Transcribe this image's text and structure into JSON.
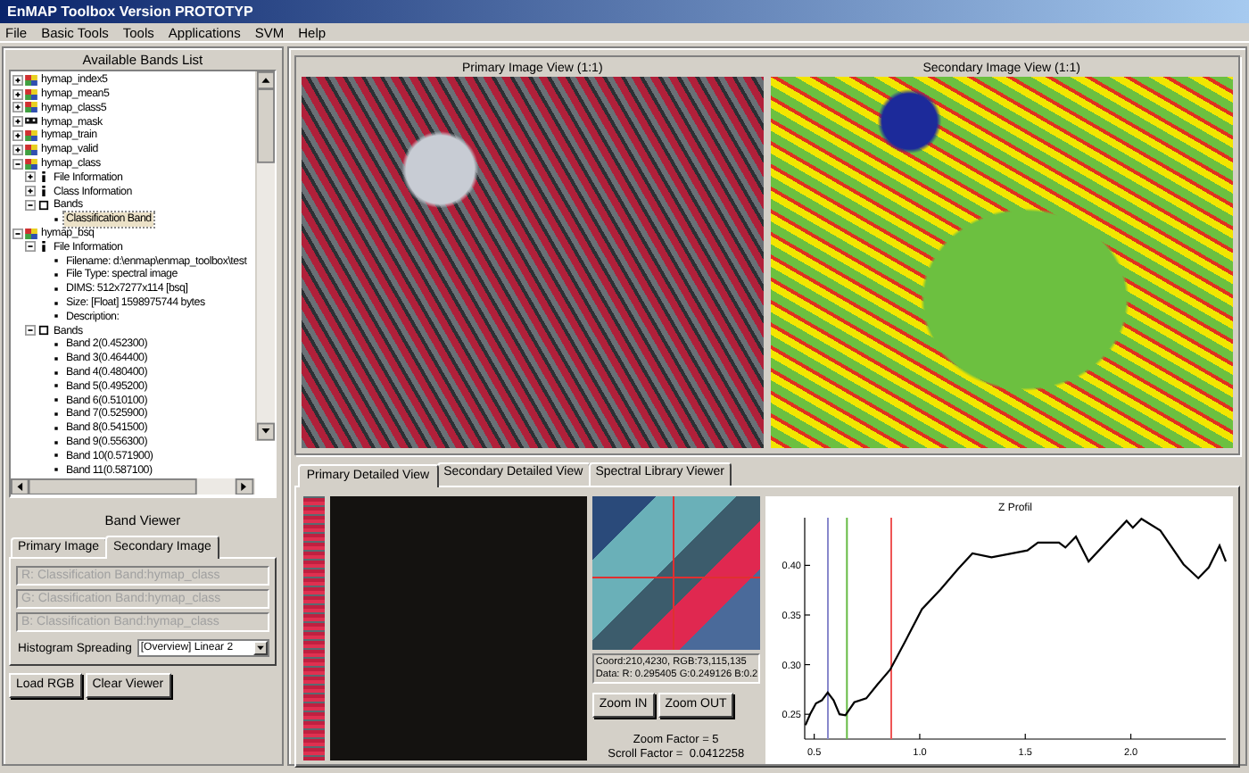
{
  "window": {
    "title": "EnMAP Toolbox Version PROTOTYP"
  },
  "menu": [
    "File",
    "Basic Tools",
    "Tools",
    "Applications",
    "SVM",
    "Help"
  ],
  "bands_list": {
    "title": "Available Bands List",
    "tree": [
      {
        "label": "hymap_index5",
        "kind": "image",
        "expanded": false,
        "selected": false
      },
      {
        "label": "hymap_mean5",
        "kind": "image",
        "expanded": false,
        "selected": false
      },
      {
        "label": "hymap_class5",
        "kind": "image",
        "expanded": false,
        "selected": false
      },
      {
        "label": "hymap_mask",
        "kind": "mask",
        "expanded": false,
        "selected": false
      },
      {
        "label": "hymap_train",
        "kind": "image",
        "expanded": false,
        "selected": false
      },
      {
        "label": "hymap_valid",
        "kind": "image",
        "expanded": false,
        "selected": false
      },
      {
        "label": "hymap_class",
        "kind": "image",
        "expanded": true,
        "selected": false,
        "children": [
          {
            "label": "File Information",
            "kind": "info",
            "expanded": false,
            "selected": false
          },
          {
            "label": "Class Information",
            "kind": "info",
            "expanded": false,
            "selected": false
          },
          {
            "label": "Bands",
            "kind": "group",
            "expanded": true,
            "selected": false,
            "children": [
              {
                "label": "Classification Band",
                "kind": "leaf",
                "selected": true
              }
            ]
          }
        ]
      },
      {
        "label": "hymap_bsq",
        "kind": "image",
        "expanded": true,
        "selected": false,
        "children": [
          {
            "label": "File Information",
            "kind": "info",
            "expanded": true,
            "selected": false,
            "children": [
              {
                "label": "Filename: d:\\enmap\\enmap_toolbox\\test",
                "kind": "leaf",
                "selected": false
              },
              {
                "label": "File Type: spectral image",
                "kind": "leaf",
                "selected": false
              },
              {
                "label": "DIMS: 512x7277x114 [bsq]",
                "kind": "leaf",
                "selected": false
              },
              {
                "label": "Size: [Float] 1598975744 bytes",
                "kind": "leaf",
                "selected": false
              },
              {
                "label": "Description:",
                "kind": "leaf",
                "selected": false
              }
            ]
          },
          {
            "label": "Bands",
            "kind": "group",
            "expanded": true,
            "selected": false,
            "children": [
              {
                "label": "Band 2(0.452300)",
                "kind": "leaf",
                "selected": false
              },
              {
                "label": "Band 3(0.464400)",
                "kind": "leaf",
                "selected": false
              },
              {
                "label": "Band 4(0.480400)",
                "kind": "leaf",
                "selected": false
              },
              {
                "label": "Band 5(0.495200)",
                "kind": "leaf",
                "selected": false
              },
              {
                "label": "Band 6(0.510100)",
                "kind": "leaf",
                "selected": false
              },
              {
                "label": "Band 7(0.525900)",
                "kind": "leaf",
                "selected": false
              },
              {
                "label": "Band 8(0.541500)",
                "kind": "leaf",
                "selected": false
              },
              {
                "label": "Band 9(0.556300)",
                "kind": "leaf",
                "selected": false
              },
              {
                "label": "Band 10(0.571900)",
                "kind": "leaf",
                "selected": false
              },
              {
                "label": "Band 11(0.587100)",
                "kind": "leaf",
                "selected": false
              }
            ]
          }
        ]
      }
    ]
  },
  "band_viewer": {
    "title": "Band Viewer",
    "tabs": [
      {
        "label": "Primary Image",
        "selected": false
      },
      {
        "label": "Secondary Image",
        "selected": true
      }
    ],
    "fields": [
      {
        "value": "R: Classification Band:hymap_class",
        "disabled": true
      },
      {
        "value": "G: Classification Band:hymap_class",
        "disabled": true
      },
      {
        "value": "B: Classification Band:hymap_class",
        "disabled": true
      }
    ],
    "histogram": {
      "label": "Histogram Spreading",
      "value": "[Overview] Linear 2"
    },
    "buttons": [
      "Load RGB",
      "Clear Viewer"
    ]
  },
  "image_views": [
    {
      "title": "Primary Image View (1:1)",
      "kind": "satellite"
    },
    {
      "title": "Secondary Image View (1:1)",
      "kind": "classification"
    }
  ],
  "detail": {
    "tabs": [
      {
        "label": "Primary Detailed View",
        "selected": true
      },
      {
        "label": "Secondary Detailed View",
        "selected": false
      },
      {
        "label": "Spectral Library Viewer",
        "selected": false
      }
    ],
    "info": [
      "Coord:210,4230, RGB:73,115,135",
      "Data: R: 0.295405 G:0.249126 B:0.2"
    ],
    "buttons": [
      "Zoom IN",
      "Zoom OUT"
    ],
    "zoom_factor": "Zoom Factor = 5",
    "scroll_factor": "Scroll Factor =  0.0412258",
    "chart_data": {
      "type": "line",
      "title": "Z Profil",
      "x": [
        0.458,
        0.48,
        0.508,
        0.536,
        0.564,
        0.592,
        0.62,
        0.648,
        0.69,
        0.747,
        0.8,
        0.86,
        0.93,
        1.01,
        1.1,
        1.18,
        1.25,
        1.34,
        1.51,
        1.56,
        1.66,
        1.69,
        1.74,
        1.8,
        1.98,
        2.01,
        2.05,
        2.14,
        2.25,
        2.32,
        2.37,
        2.42,
        2.45
      ],
      "series": [
        {
          "color": "#000000",
          "values": [
            0.239,
            0.25,
            0.261,
            0.264,
            0.272,
            0.264,
            0.25,
            0.249,
            0.262,
            0.266,
            0.28,
            0.295,
            0.323,
            0.356,
            0.376,
            0.396,
            0.412,
            0.408,
            0.415,
            0.423,
            0.423,
            0.418,
            0.429,
            0.404,
            0.445,
            0.438,
            0.447,
            0.435,
            0.401,
            0.387,
            0.398,
            0.42,
            0.404
          ]
        }
      ],
      "xlim": [
        0.455,
        2.45
      ],
      "ylim": [
        0.225,
        0.448
      ],
      "xticks": [
        {
          "value": 0.5,
          "label": "0.5"
        },
        {
          "value": 1,
          "label": "1.0"
        },
        {
          "value": 1.5,
          "label": "1.5"
        },
        {
          "value": 2,
          "label": "2.0"
        }
      ],
      "yticks": [
        {
          "value": 0.25,
          "label": "0.25"
        },
        {
          "value": 0.3,
          "label": "0.30"
        },
        {
          "value": 0.35,
          "label": "0.35"
        },
        {
          "value": 0.4,
          "label": "0.40"
        }
      ],
      "ref_lines": [
        {
          "axis": "x",
          "value": 0.565,
          "color": "#8888cc"
        },
        {
          "axis": "x",
          "value": 0.655,
          "color": "#66bb44"
        },
        {
          "axis": "x",
          "value": 0.865,
          "color": "#ee5555"
        }
      ]
    }
  }
}
